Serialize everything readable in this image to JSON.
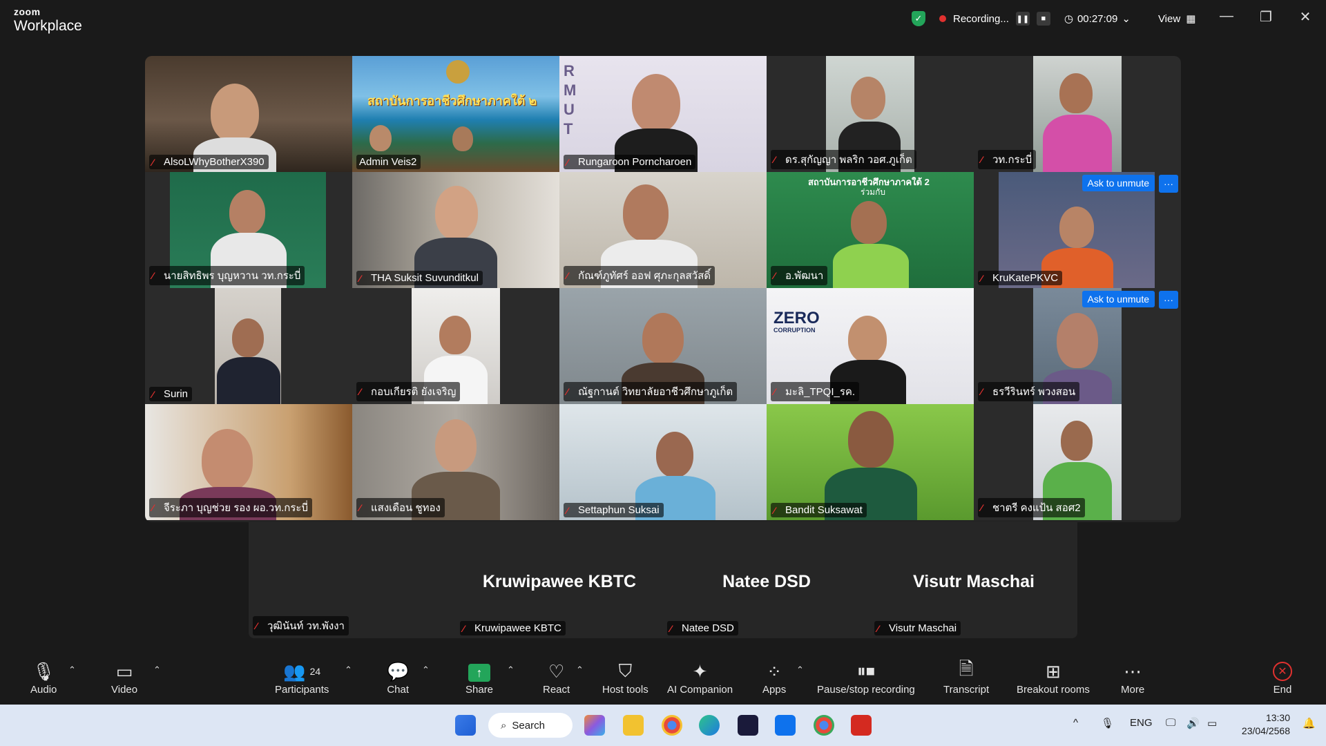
{
  "window": {
    "brand_top": "zoom",
    "brand_bottom": "Workplace",
    "recording_label": "Recording...",
    "timer": "00:27:09",
    "view_label": "View"
  },
  "gallery": {
    "tiles": [
      {
        "name": "AlsoLWhyBotherX390"
      },
      {
        "name": "Admin Veis2"
      },
      {
        "name": "Rungaroon Porncharoen"
      },
      {
        "name": "ดร.สุกัญญา  พลริก วอศ.ภูเก็ต"
      },
      {
        "name": "วท.กระบี่"
      },
      {
        "name": "นายสิทธิพร บุญหวาน วท.กระบี่"
      },
      {
        "name": "THA Suksit Suvunditkul"
      },
      {
        "name": "กัณฑ์ภูทัศร์ ออฟ ศุภะกุลสวัสดิ์"
      },
      {
        "name": "อ.พัฒนา"
      },
      {
        "name": "KruKatePKVC"
      },
      {
        "name": "Surin"
      },
      {
        "name": "กอบเกียรติ ยังเจริญ"
      },
      {
        "name": "ณัฐกานต์ วิทยาลัยอาชีวศึกษาภูเก็ต"
      },
      {
        "name": "มะลิ_TPQI_รค."
      },
      {
        "name": "ธรวีรินทร์  พวงสอน"
      },
      {
        "name": "จีระภา  บุญช่วย รอง ผอ.วท.กระบี่"
      },
      {
        "name": "แสงเดือน ชูทอง"
      },
      {
        "name": "Settaphun Suksai"
      },
      {
        "name": "Bandit Suksawat"
      },
      {
        "name": "ชาตรี คงแป้น สอศ2"
      }
    ],
    "ask_to_unmute": "Ask to unmute",
    "more_dots": "···",
    "banner_text": "สถาบันการอาชีวศึกษาภาคใต้ ๒",
    "banner_text2": "สถาบันการอาชีวศึกษาภาคใต้ 2",
    "banner_sub": "ร่วมกับ",
    "rmut_letters": [
      "R",
      "M",
      "U",
      "T"
    ],
    "zero_label": "ZERO",
    "corruption_label": "CORRUPTION"
  },
  "audio_row": [
    {
      "big": "",
      "name": "วุฒินันท์ วท.พังงา"
    },
    {
      "big": "Kruwipawee KBTC",
      "name": "Kruwipawee KBTC"
    },
    {
      "big": "Natee DSD",
      "name": "Natee DSD"
    },
    {
      "big": "Visutr Maschai",
      "name": "Visutr Maschai"
    }
  ],
  "toolbar": {
    "audio": "Audio",
    "video": "Video",
    "participants": "Participants",
    "participants_count": "24",
    "chat": "Chat",
    "share": "Share",
    "react": "React",
    "host_tools": "Host tools",
    "ai_companion": "AI Companion",
    "apps": "Apps",
    "pause_stop": "Pause/stop recording",
    "transcript": "Transcript",
    "breakout": "Breakout rooms",
    "more": "More",
    "end": "End"
  },
  "taskbar": {
    "search": "Search",
    "lang": "ENG",
    "time": "13:30",
    "date": "23/04/2568"
  },
  "colors": {
    "accent_green": "#23d18b",
    "mute_red": "#e0312f",
    "unmute_blue": "#0e72ed"
  }
}
